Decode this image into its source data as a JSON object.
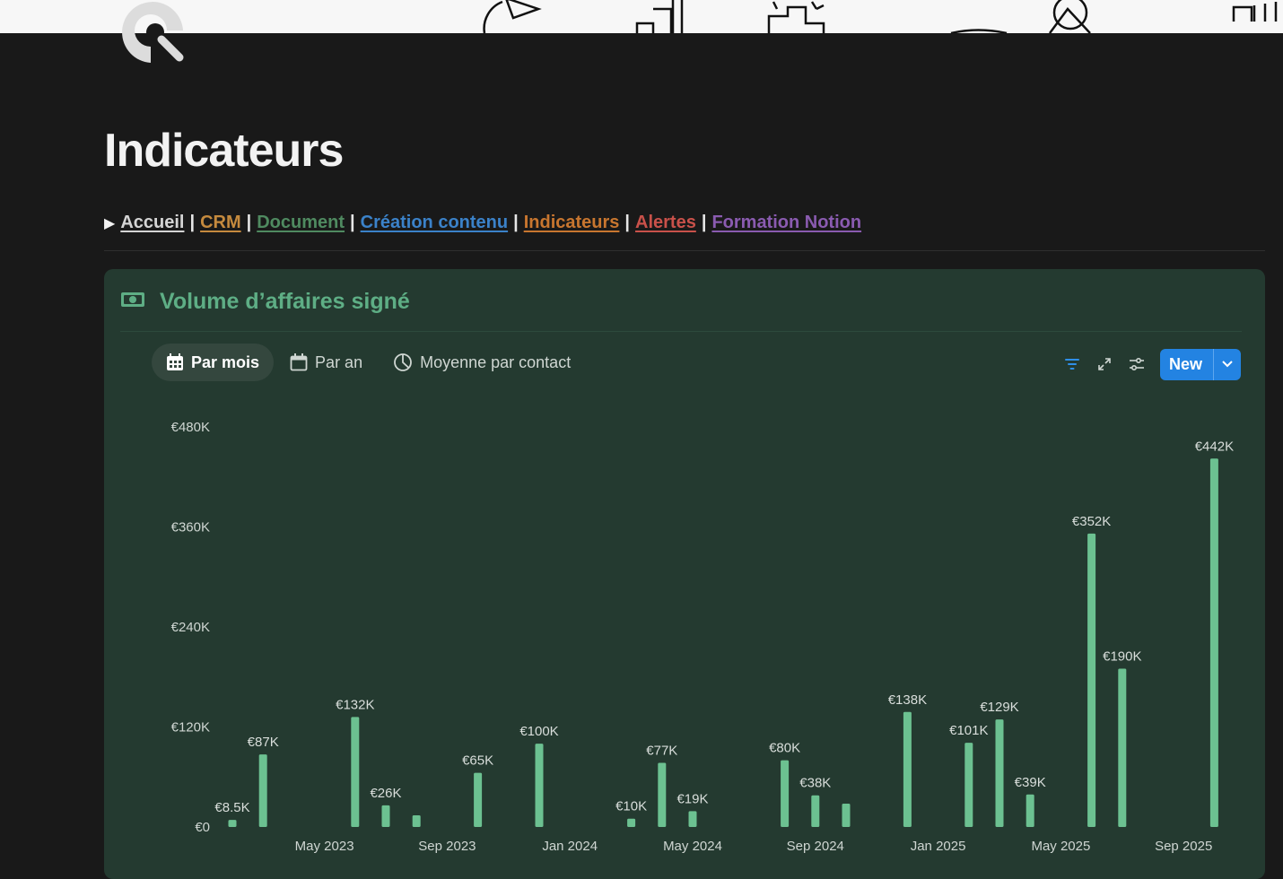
{
  "page": {
    "title": "Indicateurs",
    "nav": [
      {
        "label": "Accueil",
        "color": "#d4d4d4"
      },
      {
        "label": "CRM",
        "color": "#c58a3e"
      },
      {
        "label": "Document",
        "color": "#4f8a60"
      },
      {
        "label": "Création contenu",
        "color": "#3b82c9"
      },
      {
        "label": "Indicateurs",
        "color": "#c8762f"
      },
      {
        "label": "Alertes",
        "color": "#c9514a"
      },
      {
        "label": "Formation Notion",
        "color": "#8a5bb0"
      }
    ],
    "nav_separator": "|"
  },
  "panel": {
    "title": "Volume d’affaires signé",
    "icon": "banknote-icon",
    "accent": "#5eae85",
    "views": [
      {
        "label": "Par mois",
        "icon": "calendar-grid-icon",
        "active": true
      },
      {
        "label": "Par an",
        "icon": "calendar-icon",
        "active": false
      },
      {
        "label": "Moyenne par contact",
        "icon": "pie-chart-icon",
        "active": false
      }
    ],
    "toolbar": {
      "filter_icon": "filter-icon",
      "expand_icon": "expand-icon",
      "settings_icon": "sliders-icon",
      "new_label": "New",
      "new_color": "#2383e2"
    }
  },
  "chart_data": {
    "type": "bar",
    "series_color": "#6cc191",
    "y_ticks": [
      "€0",
      "€120K",
      "€240K",
      "€360K",
      "€480K"
    ],
    "ylim": [
      0,
      480000
    ],
    "x_ticks": [
      "May 2023",
      "Sep 2023",
      "Jan 2024",
      "May 2024",
      "Sep 2024",
      "Jan 2025",
      "May 2025",
      "Sep 2025"
    ],
    "grid": false,
    "bars": [
      {
        "month": "Feb 2023",
        "value": 8500,
        "label": "€8.5K"
      },
      {
        "month": "Mar 2023",
        "value": 87000,
        "label": "€87K"
      },
      {
        "month": "Jun 2023",
        "value": 132000,
        "label": "€132K"
      },
      {
        "month": "Jul 2023",
        "value": 26000,
        "label": "€26K"
      },
      {
        "month": "Aug 2023",
        "value": 14000,
        "label": ""
      },
      {
        "month": "Oct 2023",
        "value": 65000,
        "label": "€65K"
      },
      {
        "month": "Dec 2023",
        "value": 100000,
        "label": "€100K"
      },
      {
        "month": "Mar 2024",
        "value": 10000,
        "label": "€10K"
      },
      {
        "month": "Apr 2024",
        "value": 77000,
        "label": "€77K"
      },
      {
        "month": "May 2024",
        "value": 19000,
        "label": "€19K"
      },
      {
        "month": "Aug 2024",
        "value": 80000,
        "label": "€80K"
      },
      {
        "month": "Sep 2024",
        "value": 38000,
        "label": "€38K"
      },
      {
        "month": "Oct 2024",
        "value": 28000,
        "label": ""
      },
      {
        "month": "Dec 2024",
        "value": 138000,
        "label": "€138K"
      },
      {
        "month": "Feb 2025",
        "value": 101000,
        "label": "€101K"
      },
      {
        "month": "Mar 2025",
        "value": 129000,
        "label": "€129K"
      },
      {
        "month": "Apr 2025",
        "value": 39000,
        "label": "€39K"
      },
      {
        "month": "Jun 2025",
        "value": 352000,
        "label": "€352K"
      },
      {
        "month": "Jul 2025",
        "value": 190000,
        "label": "€190K"
      },
      {
        "month": "Oct 2025",
        "value": 442000,
        "label": "€442K"
      }
    ]
  }
}
